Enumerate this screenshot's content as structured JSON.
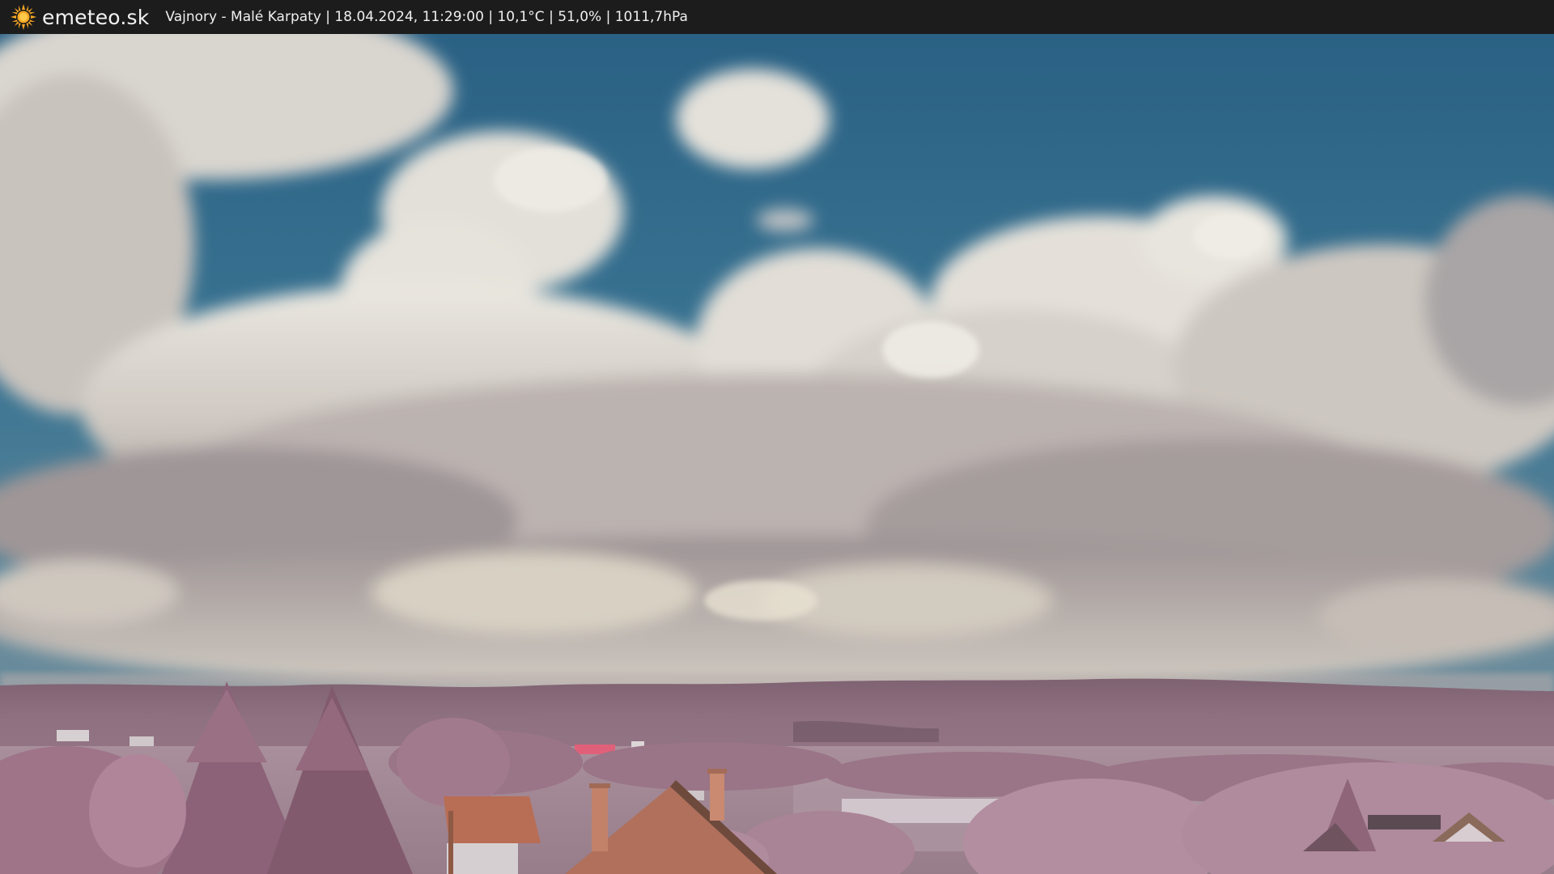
{
  "header": {
    "brand": "emeteo.sk",
    "caption": "Vajnory - Malé Karpaty | 18.04.2024, 11:29:00 | 10,1°C | 51,0% | 1011,7hPa"
  },
  "colors": {
    "bar": "#1c1c1c",
    "sun": "#f5a623",
    "sky": "#2f6a8c",
    "cloud": "#dedbd3",
    "hills": "#8a6a7a",
    "foliage": "#a77f92",
    "roof": "#b86d55"
  },
  "icons": {
    "logo": "sun-icon"
  }
}
